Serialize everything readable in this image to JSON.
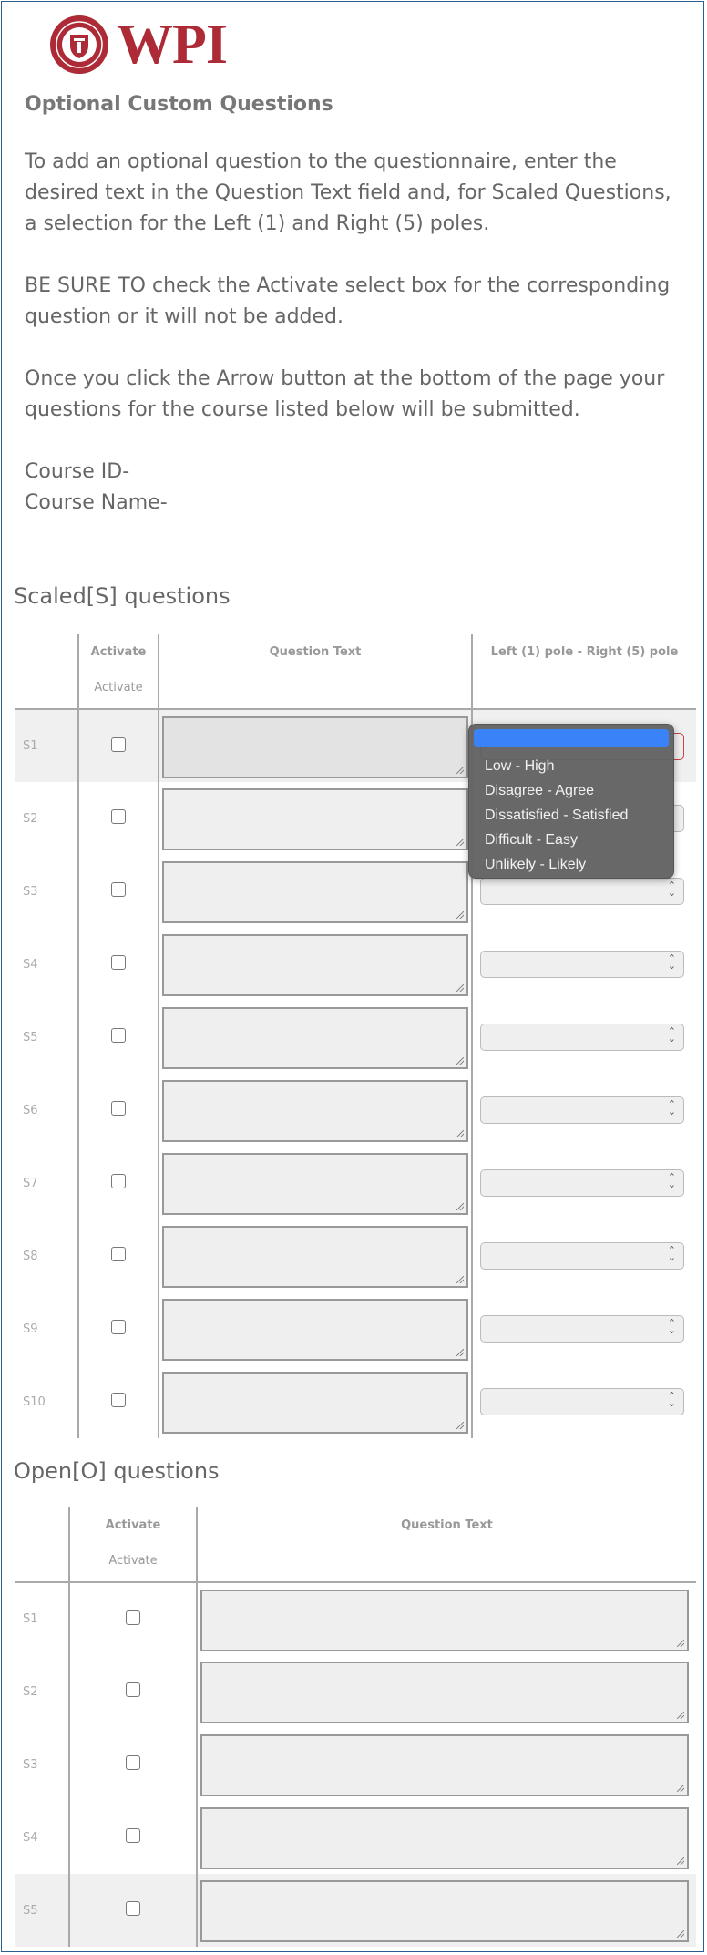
{
  "logo": {
    "text": "WPI",
    "seal_icon": "university-seal-icon"
  },
  "intro": {
    "heading": "Optional Custom Questions",
    "para1": "To add an optional question to the questionnaire, enter the desired text in the Question Text field and, for Scaled Questions, a selection for the Left (1) and Right (5) poles.",
    "para2": "BE SURE TO check the Activate select box for the corresponding question or it will not be added.",
    "para3": "Once you click the Arrow button at the bottom of the page your questions for the course listed below will be submitted.",
    "course_id_label": "Course ID-",
    "course_name_label": "Course Name-"
  },
  "scaled": {
    "title": "Scaled[S] questions",
    "col_activate": "Activate",
    "col_activate_sub": "Activate",
    "col_question": "Question Text",
    "col_pole": "Left (1) pole - Right (5) pole",
    "rows": [
      "S1",
      "S2",
      "S3",
      "S4",
      "S5",
      "S6",
      "S7",
      "S8",
      "S9",
      "S10"
    ]
  },
  "dropdown": {
    "selected": "",
    "options": [
      "Low - High",
      "Disagree - Agree",
      "Dissatisfied - Satisfied",
      "Difficult - Easy",
      "Unlikely - Likely"
    ]
  },
  "open": {
    "title": "Open[O] questions",
    "col_activate": "Activate",
    "col_activate_sub": "Activate",
    "col_question": "Question Text",
    "rows": [
      "S1",
      "S2",
      "S3",
      "S4",
      "S5"
    ]
  },
  "colors": {
    "brand": "#ac2b37",
    "select_highlight": "#3a82f7",
    "frame_border": "#2a5f8f"
  }
}
